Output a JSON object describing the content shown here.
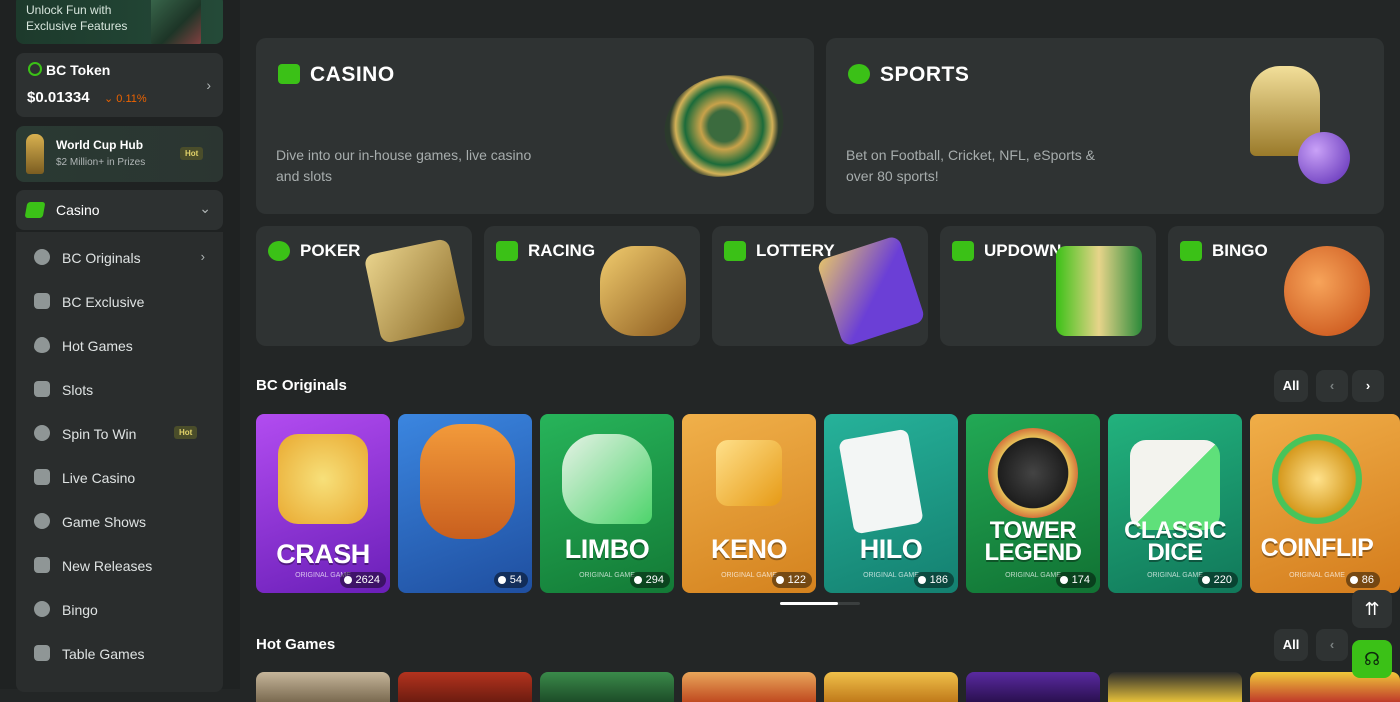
{
  "sidebar": {
    "promo": {
      "text": "Unlock Fun with Exclusive Features"
    },
    "token": {
      "name": "BC Token",
      "price": "$0.01334",
      "change": "0.11%"
    },
    "worldcup": {
      "title": "World Cup Hub",
      "subtitle": "$2 Million+ in Prizes",
      "badge": "Hot"
    },
    "casino_header": "Casino",
    "items": [
      {
        "label": "BC Originals",
        "icon": "originals-icon"
      },
      {
        "label": "BC Exclusive",
        "icon": "gamepad-icon"
      },
      {
        "label": "Hot Games",
        "icon": "fire-icon"
      },
      {
        "label": "Slots",
        "icon": "slots-icon"
      },
      {
        "label": "Spin To Win",
        "icon": "wheel-icon",
        "badge": "Hot"
      },
      {
        "label": "Live Casino",
        "icon": "live-icon"
      },
      {
        "label": "Game Shows",
        "icon": "game-shows-icon"
      },
      {
        "label": "New Releases",
        "icon": "rocket-icon"
      },
      {
        "label": "Bingo",
        "icon": "bingo-icon"
      },
      {
        "label": "Table Games",
        "icon": "table-icon"
      }
    ]
  },
  "cards": {
    "casino": {
      "title": "CASINO",
      "desc": "Dive into our in-house games, live casino and slots"
    },
    "sports": {
      "title": "SPORTS",
      "desc": "Bet on Football, Cricket, NFL, eSports & over 80 sports!"
    }
  },
  "small_cards": [
    {
      "title": "POKER"
    },
    {
      "title": "RACING"
    },
    {
      "title": "LOTTERY"
    },
    {
      "title": "UPDOWN"
    },
    {
      "title": "BINGO"
    }
  ],
  "originals": {
    "title": "BC Originals",
    "all": "All",
    "progress": 0.72,
    "games": [
      {
        "name": "CRASH",
        "sub": "ORIGINAL GAME",
        "count": "2624",
        "color": "#9a35e6"
      },
      {
        "name": "",
        "sub": "",
        "count": "54",
        "color": "#2f6fc8"
      },
      {
        "name": "LIMBO",
        "sub": "ORIGINAL GAME",
        "count": "294",
        "color": "#1f9a4a"
      },
      {
        "name": "KENO",
        "sub": "ORIGINAL GAME",
        "count": "122",
        "color": "#e39a2c"
      },
      {
        "name": "HILO",
        "sub": "ORIGINAL GAME",
        "count": "186",
        "color": "#1aa08a"
      },
      {
        "name": "TOWER LEGEND",
        "sub": "ORIGINAL GAME",
        "count": "174",
        "color": "#1f9a4a"
      },
      {
        "name": "CLASSIC DICE",
        "sub": "ORIGINAL GAME",
        "count": "220",
        "color": "#1aa47a"
      },
      {
        "name": "COINFLIP",
        "sub": "ORIGINAL GAME",
        "count": "86",
        "color": "#e39a2c"
      }
    ]
  },
  "hot": {
    "title": "Hot Games",
    "all": "All"
  },
  "colors": {
    "accent": "#3bc117",
    "bg": "#232626",
    "card": "#2f3333"
  }
}
